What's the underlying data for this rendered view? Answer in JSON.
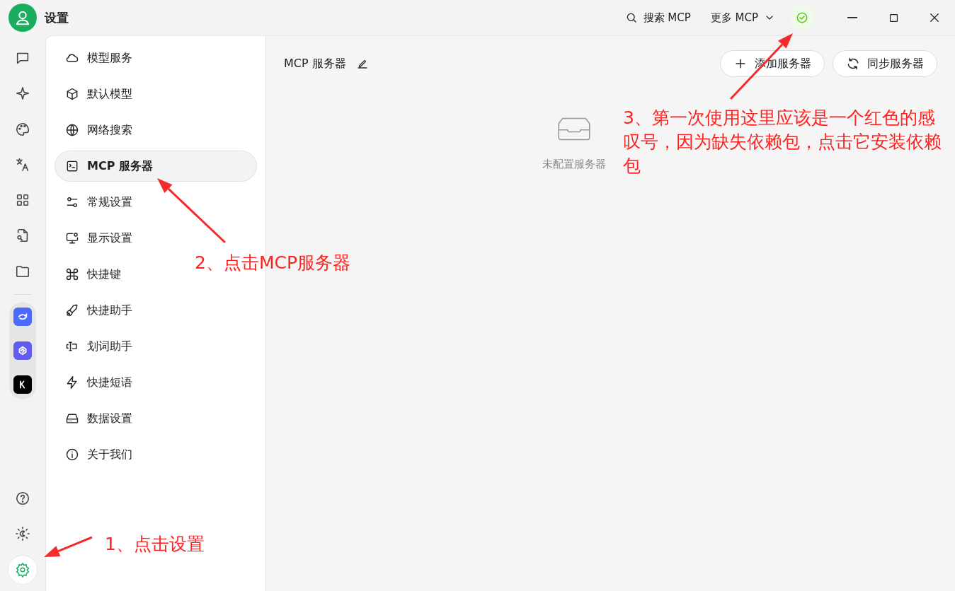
{
  "window": {
    "title": "设置",
    "search_label": "搜索 MCP",
    "more_label": "更多 MCP",
    "dependencies_missing": false
  },
  "rail": {
    "items": [
      {
        "selected": false
      },
      {
        "selected": false
      },
      {
        "selected": false
      },
      {
        "selected": false
      },
      {
        "selected": false
      },
      {
        "selected": false
      },
      {
        "selected": false
      }
    ],
    "apps": [
      {
        "color": "#4d6bfe"
      },
      {
        "color": "#615ced"
      },
      {
        "color": "#000000"
      }
    ],
    "bottom": [
      {
        "selected": false
      },
      {
        "selected": false
      },
      {
        "selected": true
      }
    ]
  },
  "menu": {
    "items": [
      {
        "label": "模型服务",
        "selected": false
      },
      {
        "label": "默认模型",
        "selected": false
      },
      {
        "label": "网络搜索",
        "selected": false
      },
      {
        "label": "MCP 服务器",
        "selected": true
      },
      {
        "label": "常规设置",
        "selected": false
      },
      {
        "label": "显示设置",
        "selected": false
      },
      {
        "label": "快捷键",
        "selected": false
      },
      {
        "label": "快捷助手",
        "selected": false
      },
      {
        "label": "划词助手",
        "selected": false
      },
      {
        "label": "快捷短语",
        "selected": false
      },
      {
        "label": "数据设置",
        "selected": false
      },
      {
        "label": "关于我们",
        "selected": false
      }
    ]
  },
  "content": {
    "title": "MCP 服务器",
    "buttons": [
      {
        "label": "添加服务器",
        "kind": "add"
      },
      {
        "label": "同步服务器",
        "kind": "sync"
      }
    ],
    "empty_text": "未配置服务器"
  },
  "annotations": [
    {
      "text": "1、点击设置"
    },
    {
      "text": "2、点击MCP服务器"
    },
    {
      "text": "3、第一次使用这里应该是一个红色的感叹号，因为缺失依赖包，点击它安装依赖包"
    }
  ]
}
